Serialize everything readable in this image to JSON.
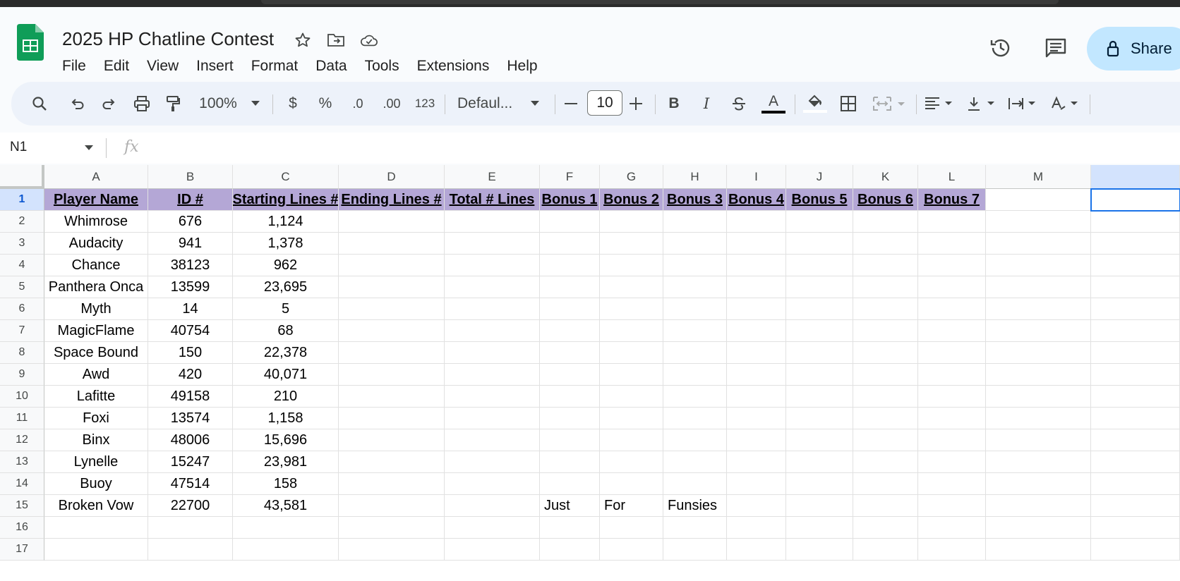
{
  "app": {
    "title": "2025 HP Chatline Contest",
    "menu": [
      "File",
      "Edit",
      "View",
      "Insert",
      "Format",
      "Data",
      "Tools",
      "Extensions",
      "Help"
    ],
    "share_label": "Share"
  },
  "toolbar": {
    "zoom": "100%",
    "currency": "$",
    "percent": "%",
    "dec_decrease": ".0",
    "dec_increase": ".00",
    "number_format": "123",
    "font": "Defaul...",
    "font_size": "10",
    "bold": "B",
    "italic": "I",
    "text_color_glyph": "A"
  },
  "formula_bar": {
    "name_box": "N1",
    "fx": "fx",
    "value": ""
  },
  "columns": [
    "A",
    "B",
    "C",
    "D",
    "E",
    "F",
    "G",
    "H",
    "I",
    "J",
    "K",
    "L",
    "M"
  ],
  "row_numbers": [
    "1",
    "2",
    "3",
    "4",
    "5",
    "6",
    "7",
    "8",
    "9",
    "10",
    "11",
    "12",
    "13",
    "14",
    "15",
    "16",
    "17"
  ],
  "header_row": [
    "Player Name",
    "ID #",
    "Starting Lines #",
    "Ending Lines #",
    "Total # Lines",
    "Bonus 1",
    "Bonus 2",
    "Bonus 3",
    "Bonus 4",
    "Bonus 5",
    "Bonus 6",
    "Bonus 7"
  ],
  "rows": [
    [
      "Whimrose",
      "676",
      "1,124"
    ],
    [
      "Audacity",
      "941",
      "1,378"
    ],
    [
      "Chance",
      "38123",
      "962"
    ],
    [
      "Panthera Onca",
      "13599",
      "23,695"
    ],
    [
      "Myth",
      "14",
      "5"
    ],
    [
      "MagicFlame",
      "40754",
      "68"
    ],
    [
      "Space Bound",
      "150",
      "22,378"
    ],
    [
      "Awd",
      "420",
      "40,071"
    ],
    [
      "Lafitte",
      "49158",
      "210"
    ],
    [
      "Foxi",
      "13574",
      "1,158"
    ],
    [
      "Binx",
      "48006",
      "15,696"
    ],
    [
      "Lynelle",
      "15247",
      "23,981"
    ],
    [
      "Buoy",
      "47514",
      "158"
    ],
    [
      "Broken Vow",
      "22700",
      "43,581"
    ]
  ],
  "row15_bonus": [
    "Just",
    "For",
    "Funsies"
  ],
  "colors": {
    "header_fill": "#b4a7d6",
    "selection": "#1a73e8",
    "sheets_green": "#0f9d58"
  }
}
